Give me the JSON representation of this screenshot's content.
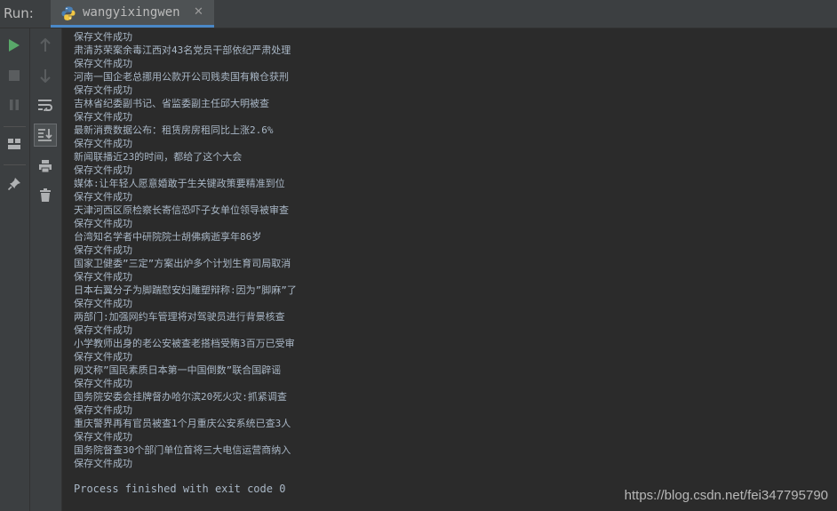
{
  "header": {
    "run_label": "Run:"
  },
  "tab": {
    "title": "wangyixingwen",
    "close": "✕",
    "icon": "python-icon"
  },
  "toolbar": {
    "left": [
      "run-icon",
      "stop-icon",
      "pause-icon",
      "layout-icon",
      "pin-icon"
    ],
    "right": [
      "arrow-up-icon",
      "arrow-down-icon",
      "soft-wrap-icon",
      "scroll-to-end-icon",
      "print-icon",
      "trash-icon"
    ]
  },
  "console": {
    "lines": [
      "保存文件成功",
      "肃清苏荣案余毒江西对43名党员干部依纪严肃处理",
      "保存文件成功",
      "河南一国企老总挪用公款开公司贱卖国有粮仓获刑",
      "保存文件成功",
      "吉林省纪委副书记、省监委副主任邱大明被查",
      "保存文件成功",
      "最新消费数据公布：租赁房房租同比上涨2.6%",
      "保存文件成功",
      "新闻联播近23的时间，都给了这个大会",
      "保存文件成功",
      "媒体:让年轻人愿意婚敢于生关键政策要精准到位",
      "保存文件成功",
      "天津河西区原检察长寄信恐吓子女单位领导被审查",
      "保存文件成功",
      "台湾知名学者中研院院士胡佛病逝享年86岁",
      "保存文件成功",
      "国家卫健委”三定”方案出炉多个计划生育司局取消",
      "保存文件成功",
      "日本右翼分子为脚踹慰安妇雕塑辩称:因为”脚麻”了",
      "保存文件成功",
      "两部门:加强网约车管理将对驾驶员进行背景核查",
      "保存文件成功",
      "小学教师出身的老公安被查老搭档受贿3百万已受审",
      "保存文件成功",
      "网文称”国民素质日本第一中国倒数”联合国辟谣",
      "保存文件成功",
      "国务院安委会挂牌督办哈尔滨20死火灾:抓紧调查",
      "保存文件成功",
      "重庆警界再有官员被查1个月重庆公安系统已查3人",
      "保存文件成功",
      "国务院督查30个部门单位首将三大电信运营商纳入",
      "保存文件成功"
    ],
    "exit_message": "Process finished with exit code 0"
  },
  "watermark": "https://blog.csdn.net/fei347795790",
  "colors": {
    "text": "#a9b7c6",
    "background": "#2b2b2b",
    "panel": "#3c3f41",
    "run_green": "#59a869"
  }
}
